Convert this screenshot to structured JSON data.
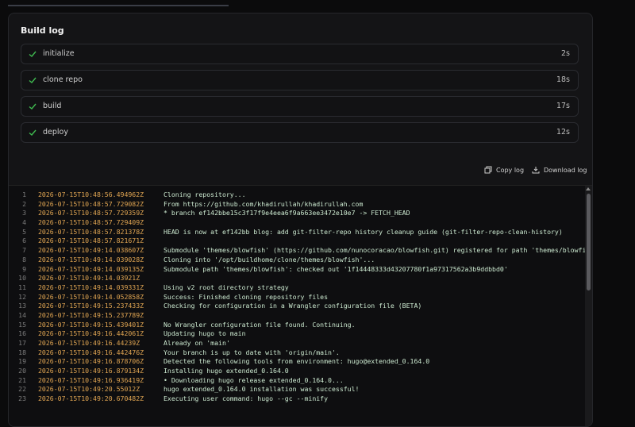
{
  "title": "Build log",
  "steps": [
    {
      "label": "initialize",
      "duration": "2s"
    },
    {
      "label": "clone repo",
      "duration": "18s"
    },
    {
      "label": "build",
      "duration": "17s"
    },
    {
      "label": "deploy",
      "duration": "12s"
    }
  ],
  "actions": {
    "copy": "Copy log",
    "download": "Download log"
  },
  "colors": {
    "success": "#3fb950",
    "timestamp": "#e0a552",
    "message": "#cbe8cf"
  },
  "icons": {
    "step": "check-icon",
    "copy": "copy-icon",
    "download": "download-icon"
  },
  "log": [
    {
      "n": "1",
      "ts": "2026-07-15T10:48:56.494962Z",
      "msg": "Cloning repository..."
    },
    {
      "n": "2",
      "ts": "2026-07-15T10:48:57.729082Z",
      "msg": "From https://github.com/khadirullah/khadirullah.com"
    },
    {
      "n": "3",
      "ts": "2026-07-15T10:48:57.729359Z",
      "msg": " * branch            ef142bbe15c3f17f9e4eea6f9a663ee3472e10e7 -> FETCH_HEAD"
    },
    {
      "n": "4",
      "ts": "2026-07-15T10:48:57.729409Z",
      "msg": ""
    },
    {
      "n": "5",
      "ts": "2026-07-15T10:48:57.821378Z",
      "msg": "HEAD is now at ef142bb blog: add git-filter-repo history cleanup guide (git-filter-repo-clean-history)"
    },
    {
      "n": "6",
      "ts": "2026-07-15T10:48:57.821671Z",
      "msg": ""
    },
    {
      "n": "7",
      "ts": "2026-07-15T10:49:14.038607Z",
      "msg": "Submodule 'themes/blowfish' (https://github.com/nunocoracao/blowfish.git) registered for path 'themes/blowfi"
    },
    {
      "n": "8",
      "ts": "2026-07-15T10:49:14.039028Z",
      "msg": "Cloning into '/opt/buildhome/clone/themes/blowfish'..."
    },
    {
      "n": "9",
      "ts": "2026-07-15T10:49:14.039135Z",
      "msg": "Submodule path 'themes/blowfish': checked out '1f14448333d43207780f1a97317562a3b9ddbbd0'"
    },
    {
      "n": "10",
      "ts": "2026-07-15T10:49:14.03921Z",
      "msg": ""
    },
    {
      "n": "11",
      "ts": "2026-07-15T10:49:14.039331Z",
      "msg": "Using v2 root directory strategy"
    },
    {
      "n": "12",
      "ts": "2026-07-15T10:49:14.052858Z",
      "msg": "Success: Finished cloning repository files"
    },
    {
      "n": "13",
      "ts": "2026-07-15T10:49:15.237433Z",
      "msg": "Checking for configuration in a Wrangler configuration file (BETA)"
    },
    {
      "n": "14",
      "ts": "2026-07-15T10:49:15.237789Z",
      "msg": ""
    },
    {
      "n": "15",
      "ts": "2026-07-15T10:49:15.439401Z",
      "msg": "No Wrangler configuration file found. Continuing."
    },
    {
      "n": "16",
      "ts": "2026-07-15T10:49:16.442061Z",
      "msg": "Updating hugo to main"
    },
    {
      "n": "17",
      "ts": "2026-07-15T10:49:16.44239Z",
      "msg": "Already on 'main'"
    },
    {
      "n": "18",
      "ts": "2026-07-15T10:49:16.442476Z",
      "msg": "Your branch is up to date with 'origin/main'."
    },
    {
      "n": "19",
      "ts": "2026-07-15T10:49:16.878706Z",
      "msg": "Detected the following tools from environment: hugo@extended_0.164.0"
    },
    {
      "n": "20",
      "ts": "2026-07-15T10:49:16.879134Z",
      "msg": "Installing hugo extended_0.164.0"
    },
    {
      "n": "21",
      "ts": "2026-07-15T10:49:16.936419Z",
      "msg": "• Downloading hugo release extended_0.164.0..."
    },
    {
      "n": "22",
      "ts": "2026-07-15T10:49:20.55012Z",
      "msg": "hugo extended_0.164.0 installation was successful!"
    },
    {
      "n": "23",
      "ts": "2026-07-15T10:49:20.670482Z",
      "msg": "Executing user command: hugo --gc --minify"
    }
  ]
}
